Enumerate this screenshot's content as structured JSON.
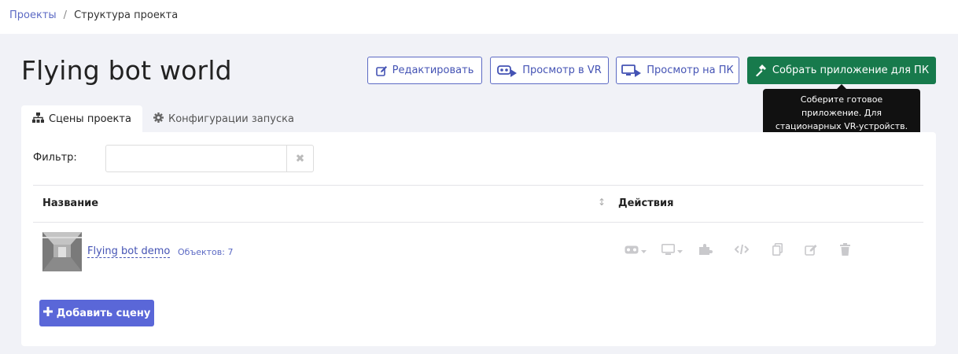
{
  "breadcrumb": {
    "items": [
      {
        "label": "Проекты"
      },
      {
        "label": "Структура проекта"
      }
    ],
    "separator": "/"
  },
  "page": {
    "title": "Flying bot world"
  },
  "toolbar": {
    "edit_label": "Редактировать",
    "vr_preview_label": "Просмотр в VR",
    "pc_preview_label": "Просмотр на ПК",
    "build_label": "Собрать приложение для ПК"
  },
  "tooltip": {
    "text": "Соберите готовое приложение. Для стационарных VR-устройств."
  },
  "tabs": [
    {
      "label": "Сцены проекта",
      "icon": "sitemap-icon",
      "active": true
    },
    {
      "label": "Конфигурации запуска",
      "icon": "gear-icon",
      "active": false
    }
  ],
  "filter": {
    "label": "Фильтр:",
    "value": "",
    "placeholder": ""
  },
  "table": {
    "columns": [
      "Название",
      "Действия"
    ],
    "rows": [
      {
        "name": "Flying bot demo",
        "objects": "Объектов: 7",
        "actions": [
          "vr-headset-icon",
          "monitor-icon",
          "puzzle-icon",
          "code-icon",
          "copy-icon",
          "edit-icon",
          "trash-icon"
        ]
      }
    ]
  },
  "add_scene": {
    "label": "Добавить сцену"
  },
  "colors": {
    "accent": "#5c6ac4",
    "primary_button": "#5a67d8",
    "build_button": "#177a4c",
    "background": "#f1f2f7",
    "tooltip": "#111111"
  }
}
